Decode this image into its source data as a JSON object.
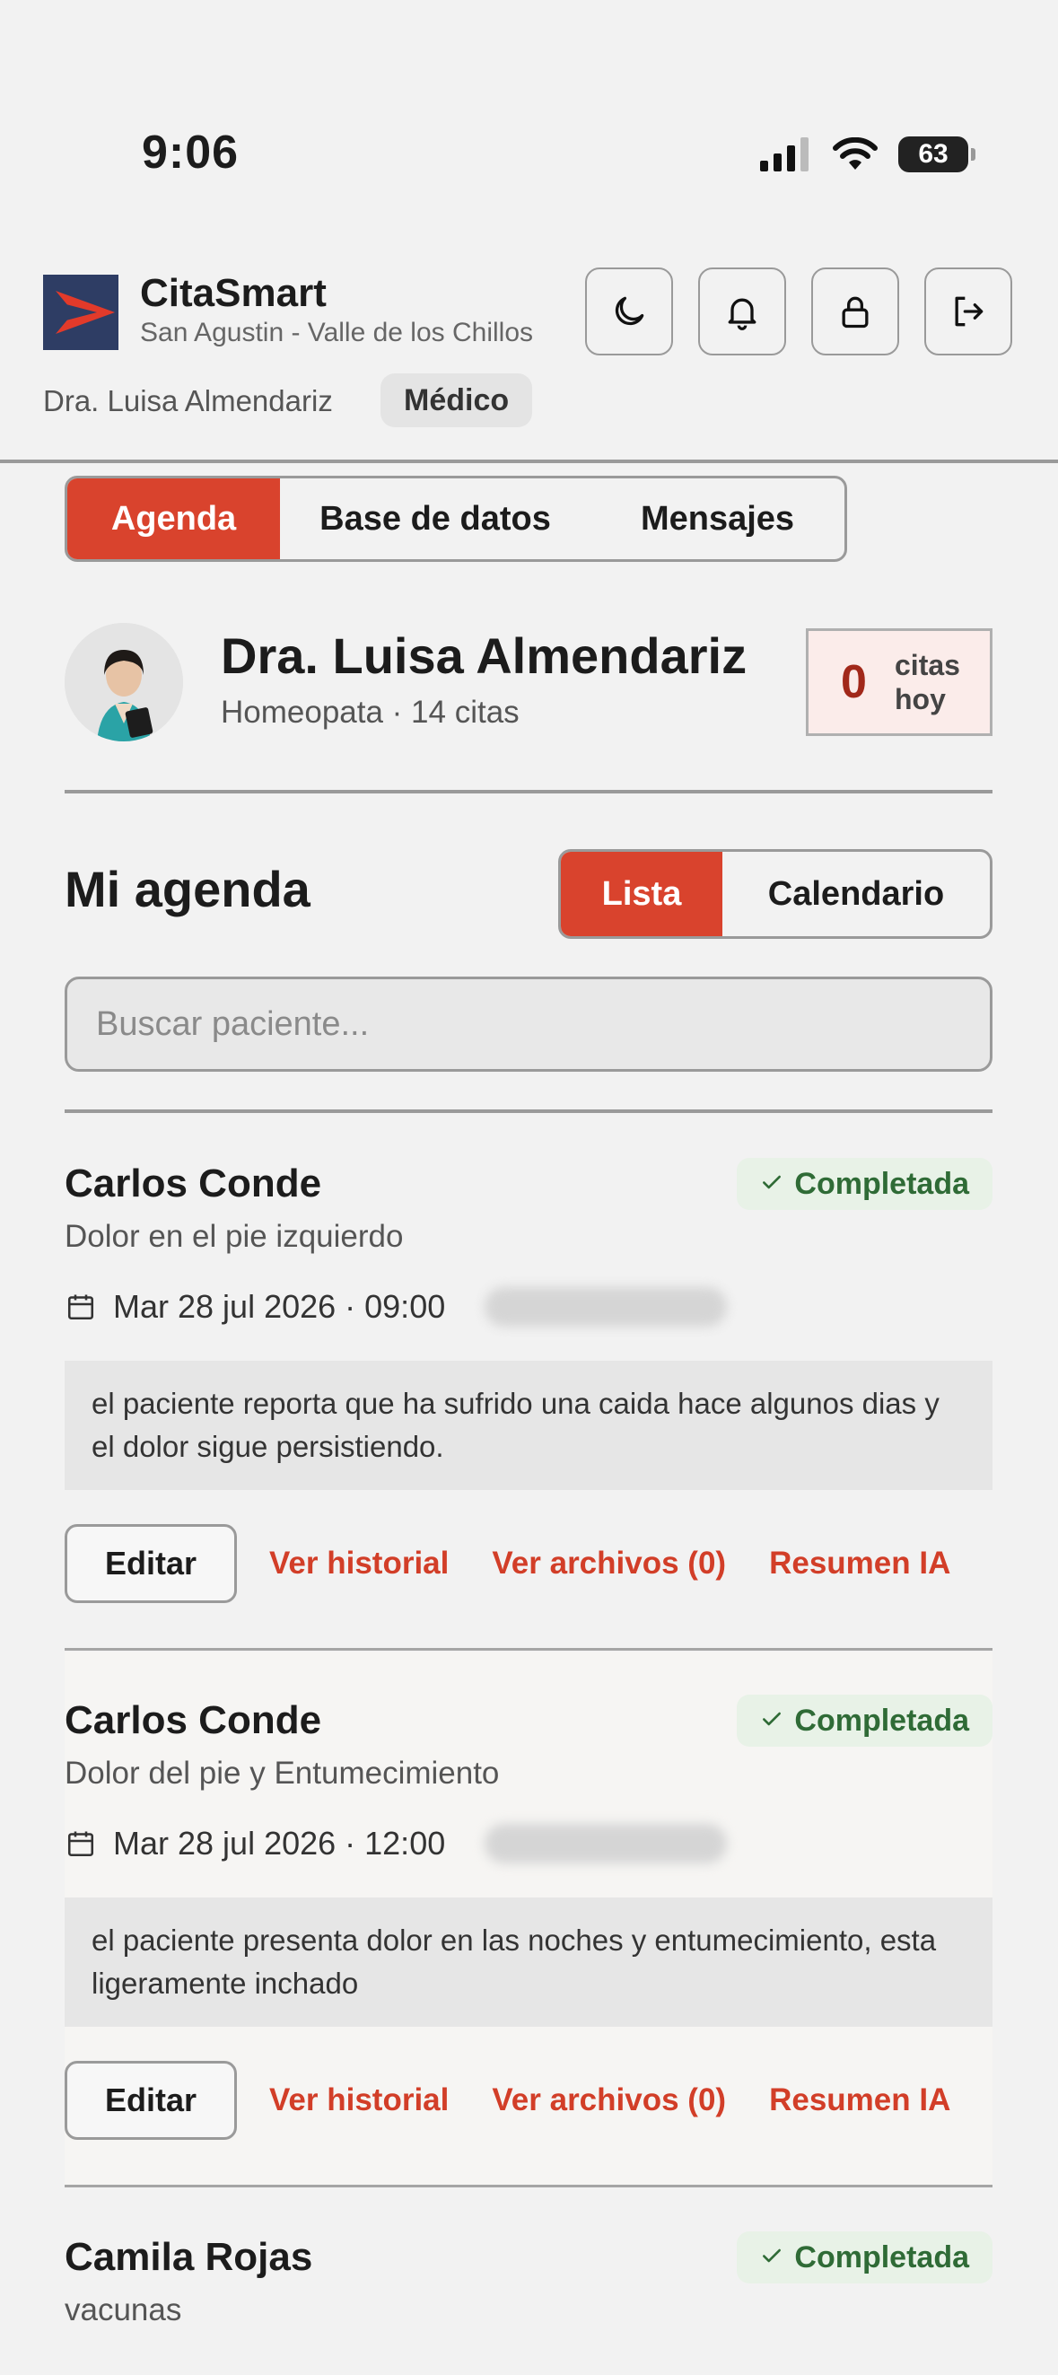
{
  "status_bar": {
    "time": "9:06",
    "battery": "63"
  },
  "header": {
    "app_title": "CitaSmart",
    "location": "San Agustin - Valle de los Chillos",
    "user_name": "Dra. Luisa Almendariz",
    "role": "Médico",
    "buttons": [
      "moon-icon",
      "bell-icon",
      "lock-icon",
      "logout-icon"
    ]
  },
  "tabs": [
    "Agenda",
    "Base de datos",
    "Mensajes"
  ],
  "doctor": {
    "name": "Dra. Luisa Almendariz",
    "subtitle": "Homeopata · 14 citas",
    "today_count": "0",
    "today_label_1": "citas",
    "today_label_2": "hoy"
  },
  "agenda": {
    "title": "Mi agenda",
    "view_options": [
      "Lista",
      "Calendario"
    ],
    "search_placeholder": "Buscar paciente..."
  },
  "appointments": [
    {
      "patient": "Carlos Conde",
      "status": "Completada",
      "reason": "Dolor en el pie izquierdo",
      "datetime": "Mar 28 jul 2026 · 09:00",
      "note": "el paciente reporta que ha sufrido una caida hace algunos dias y el dolor sigue persistiendo.",
      "actions": {
        "edit": "Editar",
        "history": "Ver historial",
        "files": "Ver archivos (0)",
        "ai": "Resumen IA"
      }
    },
    {
      "patient": "Carlos Conde",
      "status": "Completada",
      "reason": "Dolor del pie y Entumecimiento",
      "datetime": "Mar 28 jul 2026 · 12:00",
      "note": "el paciente presenta dolor en las noches y entumecimiento, esta ligeramente inchado",
      "actions": {
        "edit": "Editar",
        "history": "Ver historial",
        "files": "Ver archivos (0)",
        "ai": "Resumen IA"
      }
    },
    {
      "patient": "Camila Rojas",
      "status": "Completada",
      "reason": "vacunas"
    }
  ],
  "colors": {
    "accent": "#d9432d",
    "status_green": "#2f6b36",
    "brand_navy": "#2e3d64"
  }
}
